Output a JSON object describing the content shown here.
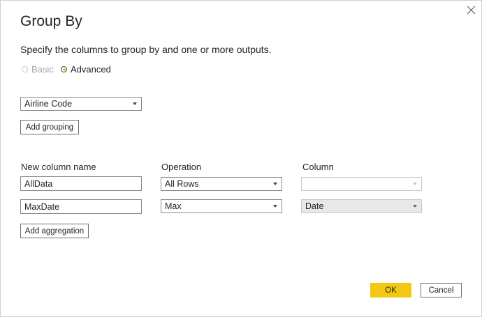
{
  "dialog": {
    "title": "Group By",
    "subtitle": "Specify the columns to group by and one or more outputs."
  },
  "mode": {
    "basic_label": "Basic",
    "advanced_label": "Advanced",
    "selected": "Advanced"
  },
  "grouping": {
    "columns": [
      "Airline Code"
    ],
    "add_label": "Add grouping"
  },
  "aggregation": {
    "headers": {
      "name": "New column name",
      "operation": "Operation",
      "column": "Column"
    },
    "rows": [
      {
        "name": "AllData",
        "operation": "All Rows",
        "column": ""
      },
      {
        "name": "MaxDate",
        "operation": "Max",
        "column": "Date"
      }
    ],
    "add_label": "Add aggregation"
  },
  "footer": {
    "ok_label": "OK",
    "cancel_label": "Cancel"
  },
  "colors": {
    "accent": "#f2c811",
    "border": "#8a8886"
  },
  "icons": {
    "close": "close-icon",
    "dropdown": "chevron-down-icon"
  }
}
